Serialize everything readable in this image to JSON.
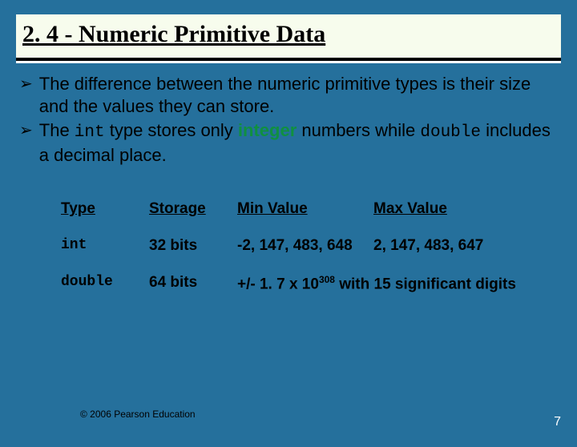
{
  "title": "2. 4 - Numeric Primitive Data",
  "bullets": [
    {
      "pre": "The difference between the numeric primitive types is their size and the values they can store."
    },
    {
      "pre": "The ",
      "code1": "int",
      "mid": " type stores only ",
      "green": "integer",
      "post1": " numbers while ",
      "code2": "double",
      "post2": " includes a decimal place."
    }
  ],
  "table": {
    "headers": [
      "Type",
      "Storage",
      "Min Value",
      "Max Value"
    ],
    "rows": [
      {
        "type": "int",
        "storage": "32 bits",
        "min": "-2, 147, 483, 648",
        "max": "2, 147, 483, 647"
      },
      {
        "type": "double",
        "storage": "64 bits",
        "combined_pre": "+/- 1. 7 x 10",
        "combined_exp": "308",
        "combined_post": " with 15 significant digits"
      }
    ]
  },
  "footer": "© 2006 Pearson Education",
  "page": "7"
}
